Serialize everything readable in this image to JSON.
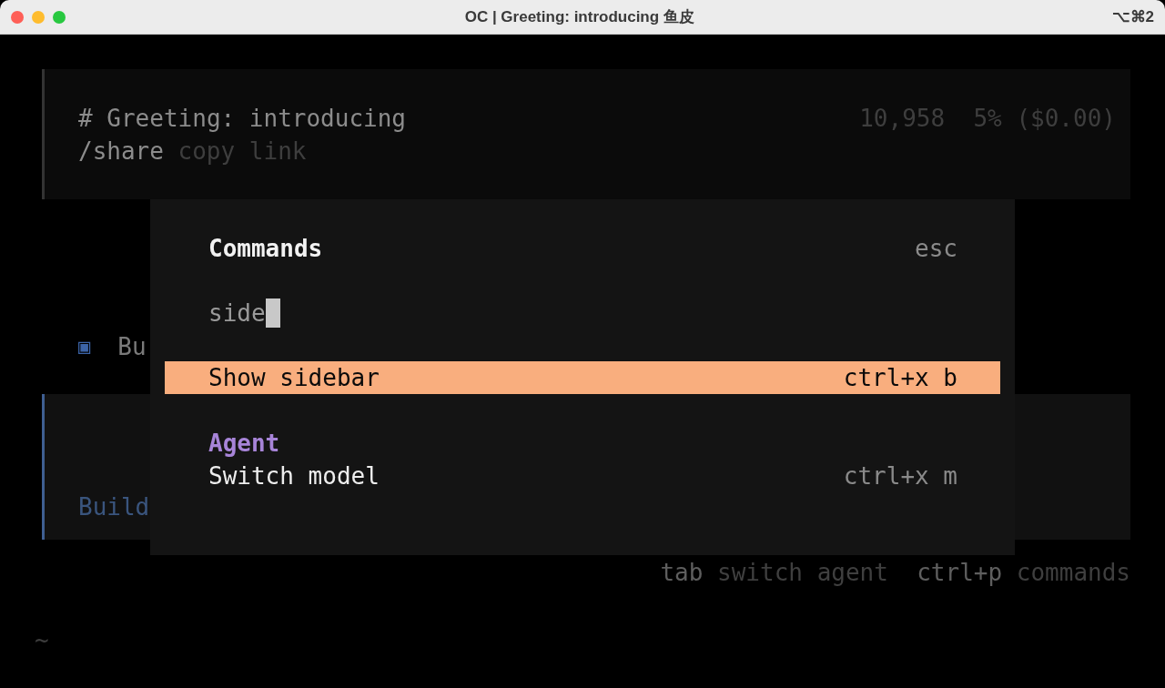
{
  "window": {
    "title": "OC | Greeting: introducing 鱼皮",
    "shortcut": "⌥⌘2"
  },
  "session": {
    "title": "# Greeting: introducing",
    "share_command": "/share",
    "share_hint": "copy link",
    "tokens": "10,958",
    "context": "5% ($0.00)"
  },
  "status": {
    "icon": "▣",
    "text": "Bu"
  },
  "prompt": {
    "agent_label": "Build"
  },
  "footer": [
    {
      "key": "tab",
      "label": "switch agent"
    },
    {
      "key": "ctrl+p",
      "label": "commands"
    }
  ],
  "shell_line": "~",
  "dialog": {
    "title": "Commands",
    "close_hint": "esc",
    "query": "side",
    "groups": [
      {
        "items": [
          {
            "label": "Show sidebar",
            "shortcut": "ctrl+x b",
            "selected": true
          }
        ]
      },
      {
        "heading": "Agent",
        "items": [
          {
            "label": "Switch model",
            "shortcut": "ctrl+x m",
            "selected": false
          }
        ]
      }
    ]
  }
}
